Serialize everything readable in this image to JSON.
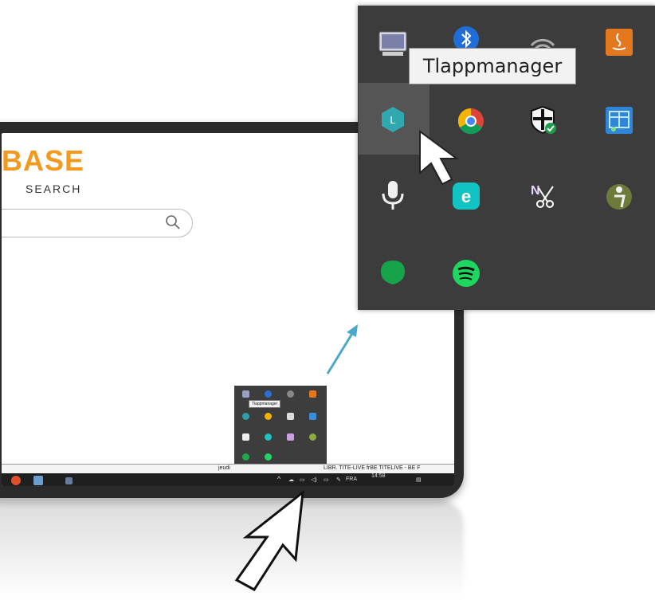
{
  "site": {
    "logo": "BASE",
    "logo_sub": "SEARCH"
  },
  "statusbar": {
    "left_text": "jeudi",
    "right_text": "LIBR. TITE-LIVE frBE TITELIVE - BE F"
  },
  "taskbar": {
    "time": "14:58",
    "language": "FRA"
  },
  "tooltip": {
    "label": "Tlappmanager"
  },
  "mini_tooltip": {
    "label": "Tlappmanager"
  },
  "tray_icons": [
    "monitor-icon",
    "bluetooth-icon",
    "wifi-icon",
    "java-icon",
    "tlappmanager-icon",
    "chrome-icon",
    "security-shield-icon",
    "network-grid-icon",
    "microphone-icon",
    "eset-icon",
    "onenote-clipper-icon",
    "accessibility-icon",
    "green-balloon-icon",
    "spotify-icon"
  ],
  "colors": {
    "accent_orange": "#f39a1e",
    "tray_bg": "#3c3c3c",
    "connector": "#4aa8c8"
  }
}
